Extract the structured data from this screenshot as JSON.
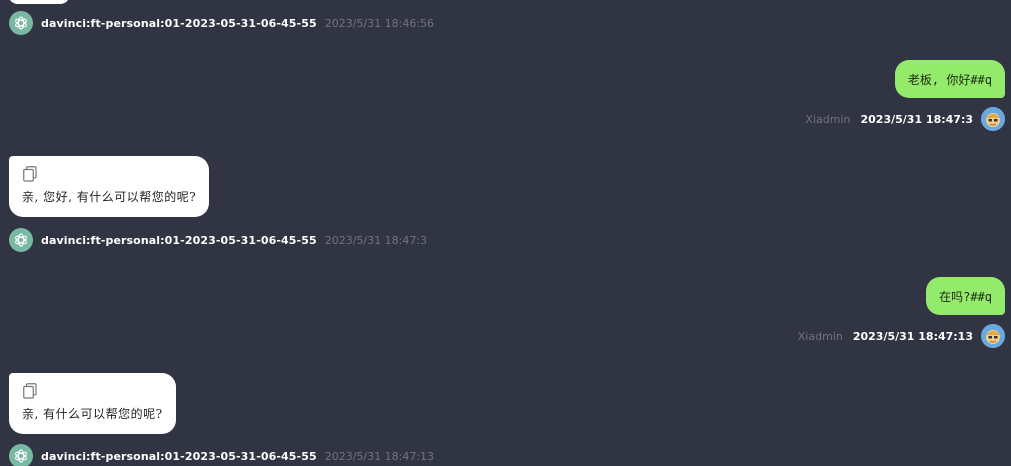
{
  "bot": {
    "name": "davinci:ft-personal:01-2023-05-31-06-45-55"
  },
  "user": {
    "name": "Xiadmin"
  },
  "colors": {
    "background": "#313443",
    "user_bubble": "#94ea6a",
    "bot_bubble": "#ffffff",
    "bot_avatar": "#79b8a2",
    "muted_text": "#6f7282"
  },
  "messages": [
    {
      "role": "bot",
      "text": "",
      "time": "2023/5/31 18:46:56",
      "cut_off": true
    },
    {
      "role": "user",
      "text": "老板, 你好##q",
      "time": "2023/5/31 18:47:3"
    },
    {
      "role": "bot",
      "text": "亲, 您好, 有什么可以帮您的呢?",
      "time": "2023/5/31 18:47:3",
      "icon": "copy-icon"
    },
    {
      "role": "user",
      "text": "在吗?##q",
      "time": "2023/5/31 18:47:13"
    },
    {
      "role": "bot",
      "text": "亲, 有什么可以帮您的呢?",
      "time": "2023/5/31 18:47:13",
      "icon": "copy-icon"
    }
  ]
}
